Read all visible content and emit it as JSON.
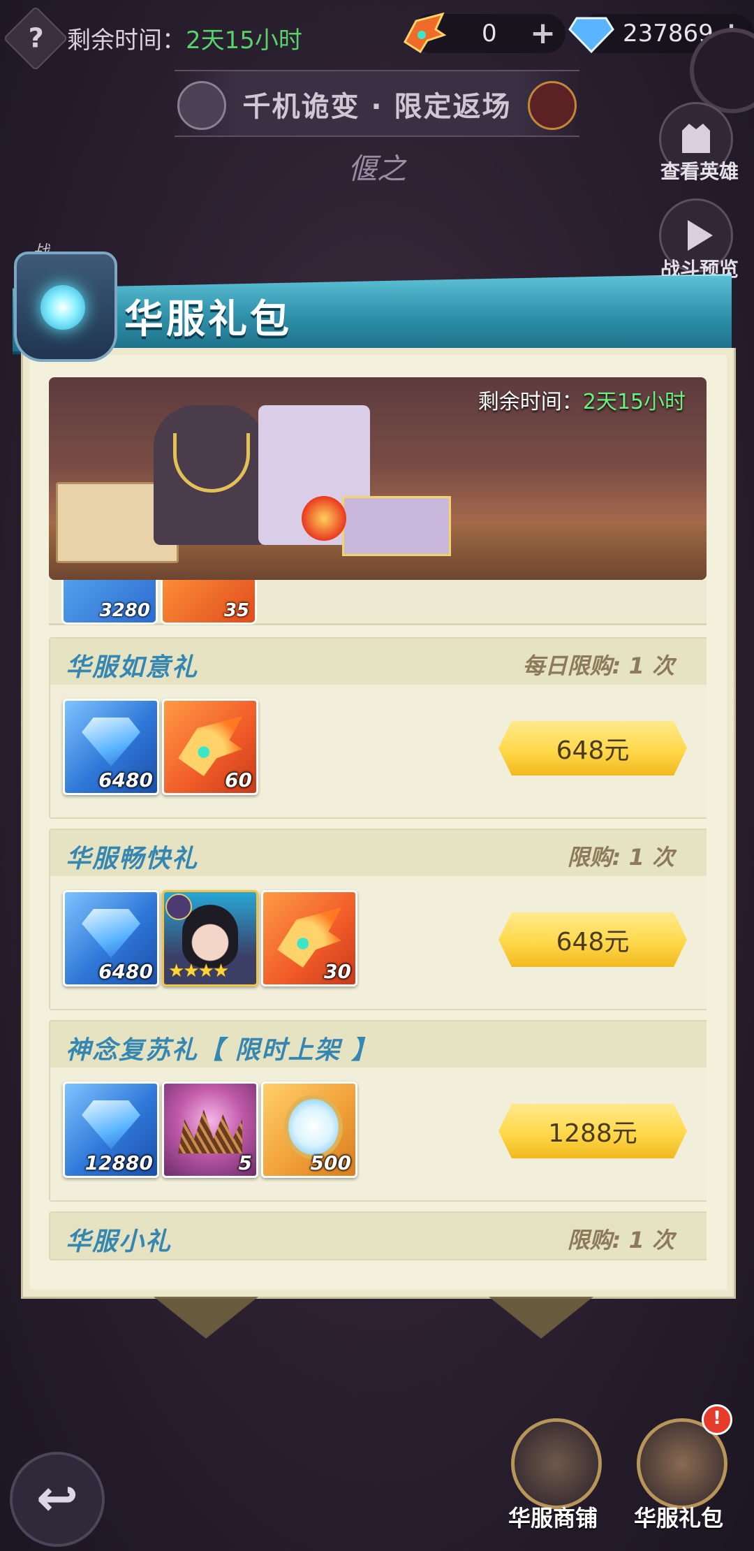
{
  "top": {
    "help": "?",
    "remain_label": "剩余时间：",
    "remain_value": "2天15小时",
    "currency1_value": "0",
    "currency2_value": "237869",
    "plus": "+"
  },
  "event": {
    "title": "千机诡变 · 限定返场",
    "hero_name": "偃之"
  },
  "side": {
    "view_hero": "查看英雄",
    "battle_preview": "战斗预览"
  },
  "panel": {
    "tab_stub": "战",
    "title": "华服礼包",
    "banner_remain_label": "剩余时间：",
    "banner_remain_value": "2天15小时"
  },
  "prev_item": {
    "count1": "3280",
    "count2": "35"
  },
  "packs": [
    {
      "name": "华服如意礼",
      "limit": "每日限购: 1 次",
      "items": [
        {
          "type": "diamond-icon",
          "count": "6480"
        },
        {
          "type": "wing-token-icon",
          "count": "60"
        }
      ],
      "price": "648元"
    },
    {
      "name": "华服畅快礼",
      "limit": "限购: 1 次",
      "items": [
        {
          "type": "diamond-icon",
          "count": "6480"
        },
        {
          "type": "hero-portrait",
          "count": "",
          "stars": "★★★★"
        },
        {
          "type": "wing-token-icon",
          "count": "30"
        }
      ],
      "price": "648元"
    },
    {
      "name": "神念复苏礼【 限时上架 】",
      "limit": "",
      "items": [
        {
          "type": "diamond-icon",
          "count": "12880"
        },
        {
          "type": "thorn-crown-icon",
          "count": "5"
        },
        {
          "type": "mirror-icon",
          "count": "500"
        }
      ],
      "price": "1288元"
    },
    {
      "name": "华服小礼",
      "limit": "限购: 1 次"
    }
  ],
  "bottom": {
    "back": "↩",
    "shop_label": "华服商铺",
    "gift_label": "华服礼包",
    "notif": "!"
  }
}
